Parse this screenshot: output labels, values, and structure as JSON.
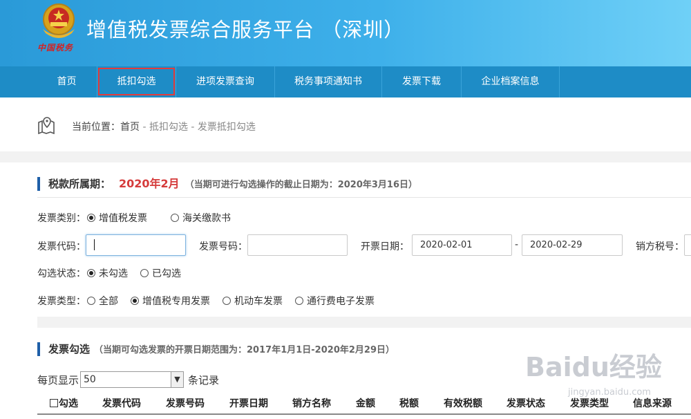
{
  "header": {
    "title": "增值税发票综合服务平台 （深圳）",
    "logo_text": "中国税务",
    "colors": {
      "primary": "#2a9ad8",
      "nav": "#1e8cc6",
      "accent_red": "#d53b3b",
      "active_border": "#e53b3b"
    }
  },
  "nav": {
    "items": [
      {
        "label": "首页"
      },
      {
        "label": "抵扣勾选",
        "active": true
      },
      {
        "label": "进项发票查询"
      },
      {
        "label": "税务事项通知书"
      },
      {
        "label": "发票下载"
      },
      {
        "label": "企业档案信息"
      }
    ]
  },
  "breadcrumb": {
    "prefix": "当前位置：",
    "home": "首页",
    "sep1": " - ",
    "level2": "抵扣勾选",
    "sep2": " - ",
    "level3": "发票抵扣勾选"
  },
  "section1": {
    "title": "税款所属期：",
    "period": "2020年2月",
    "note": "（当期可进行勾选操作的截止日期为：2020年3月16日）"
  },
  "filters": {
    "invoice_category_label": "发票类别：",
    "invoice_category_options": [
      {
        "label": "增值税发票",
        "selected": true
      },
      {
        "label": "海关缴款书",
        "selected": false
      }
    ],
    "invoice_code_label": "发票代码：",
    "invoice_code_value": "",
    "invoice_number_label": "发票号码：",
    "invoice_number_value": "",
    "issue_date_label": "开票日期：",
    "date_from": "2020-02-01",
    "date_sep": "-",
    "date_to": "2020-02-29",
    "seller_tax_label": "销方税号：",
    "check_status_label": "勾选状态：",
    "check_status_options": [
      {
        "label": "未勾选",
        "selected": true
      },
      {
        "label": "已勾选",
        "selected": false
      }
    ],
    "invoice_type_label": "发票类型：",
    "invoice_type_options": [
      {
        "label": "全部",
        "selected": false
      },
      {
        "label": "增值税专用发票",
        "selected": true
      },
      {
        "label": "机动车发票",
        "selected": false
      },
      {
        "label": "通行费电子发票",
        "selected": false
      }
    ]
  },
  "section2": {
    "title": "发票勾选",
    "note": "（当期可勾选发票的开票日期范围为：2017年1月1日-2020年2月29日）"
  },
  "pagination": {
    "prefix": "每页显示",
    "value": "50",
    "suffix": "条记录"
  },
  "table": {
    "columns": [
      "勾选",
      "发票代码",
      "发票号码",
      "开票日期",
      "销方名称",
      "金额",
      "税额",
      "有效税额",
      "发票状态",
      "发票类型",
      "信息来源"
    ]
  },
  "watermark": {
    "brand": "Baidu经验",
    "url": "jingyan.baidu.com"
  }
}
